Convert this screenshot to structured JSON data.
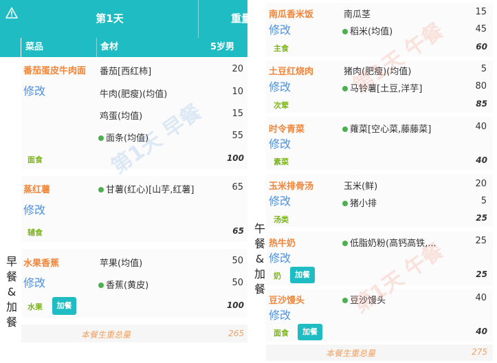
{
  "left": {
    "day_title": "第1天",
    "weight_header": "重量",
    "columns": {
      "dish": "菜品",
      "ingredient": "食材",
      "age": "5岁男"
    },
    "meal_label": "早餐&加餐",
    "watermark": "第1天 早餐",
    "sections": [
      {
        "dish": "番茄蛋皮牛肉面",
        "edit": "修改",
        "tag": "面食",
        "subtotal": "100",
        "items": [
          {
            "name": "番茄[西红柿]",
            "qty": "20",
            "dot": false
          },
          {
            "name": "牛肉(肥瘦)(均值)",
            "qty": "10",
            "dot": false
          },
          {
            "name": "鸡蛋(均值)",
            "qty": "15",
            "dot": false
          },
          {
            "name": "面条(均值)",
            "qty": "55",
            "dot": true
          }
        ]
      },
      {
        "dish": "蒸红薯",
        "edit": "修改",
        "tag": "辅食",
        "subtotal": "65",
        "items": [
          {
            "name": "甘薯(红心)[山芋,红薯]",
            "qty": "65",
            "dot": true
          }
        ]
      },
      {
        "dish": "水果香蕉",
        "edit": "修改",
        "tag": "水果",
        "button": "加餐",
        "subtotal": "100",
        "items": [
          {
            "name": "苹果(均值)",
            "qty": "50",
            "dot": false
          },
          {
            "name": "香蕉(黄皮)",
            "qty": "50",
            "dot": true
          }
        ]
      }
    ],
    "total_label": "本餐生重总量",
    "total_value": "265"
  },
  "right": {
    "meal_label": "午餐&加餐",
    "watermark": "第1天 午餐",
    "sections": [
      {
        "dish": "南瓜香米饭",
        "edit": "修改",
        "tag": "主食",
        "subtotal": "60",
        "items": [
          {
            "name": "南瓜茎",
            "qty": "15",
            "dot": false
          },
          {
            "name": "稻米(均值)",
            "qty": "45",
            "dot": true
          }
        ]
      },
      {
        "dish": "土豆红烧肉",
        "edit": "修改",
        "tag": "次荤",
        "subtotal": "85",
        "items": [
          {
            "name": "猪肉(肥瘦)(均值)",
            "qty": "5",
            "dot": false
          },
          {
            "name": "马铃薯[土豆,洋芋]",
            "qty": "80",
            "dot": true
          }
        ]
      },
      {
        "dish": "时令青菜",
        "edit": "修改",
        "tag": "素菜",
        "subtotal": "40",
        "items": [
          {
            "name": "蕹菜[空心菜,藤藤菜]",
            "qty": "40",
            "dot": true
          }
        ]
      },
      {
        "dish": "玉米排骨汤",
        "edit": "修改",
        "tag": "汤类",
        "subtotal": "25",
        "items": [
          {
            "name": "玉米(鲜)",
            "qty": "20",
            "dot": false
          },
          {
            "name": "猪小排",
            "qty": "5",
            "dot": true
          }
        ]
      },
      {
        "dish": "热牛奶",
        "edit": "修改",
        "tag": "奶",
        "button": "加餐",
        "subtotal": "25",
        "items": [
          {
            "name": "低脂奶粉(高钙高铁,...",
            "qty": "25",
            "dot": true
          }
        ]
      },
      {
        "dish": "豆沙馒头",
        "edit": "修改",
        "tag": "面食",
        "button": "加餐",
        "subtotal": "40",
        "items": [
          {
            "name": "豆沙馒头",
            "qty": "40",
            "dot": true
          }
        ]
      }
    ],
    "total_label": "本餐生重总量",
    "total_value": "275"
  },
  "icons": {
    "warning": "warning-triangle-icon",
    "dot": "green-dot-icon"
  },
  "colors": {
    "header": "#1fbdc3",
    "dish": "#f0863a",
    "edit": "#4a90e2",
    "tag": "#7cb518",
    "dot": "#4caf50"
  }
}
